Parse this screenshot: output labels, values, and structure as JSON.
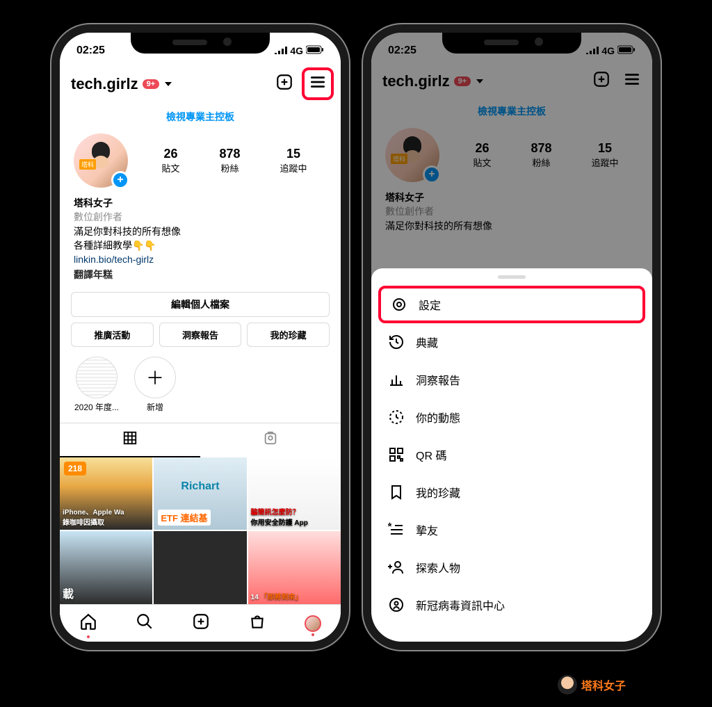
{
  "status": {
    "time": "02:25",
    "network": "4G"
  },
  "header": {
    "username": "tech.girlz",
    "badge": "9+"
  },
  "dashboard_link": "檢視專業主控板",
  "stats": {
    "posts": {
      "num": "26",
      "label": "貼文"
    },
    "followers": {
      "num": "878",
      "label": "粉絲"
    },
    "following": {
      "num": "15",
      "label": "追蹤中"
    }
  },
  "bio": {
    "name": "塔科女子",
    "category": "數位創作者",
    "line1": "滿足你對科技的所有想像",
    "line2": "各種詳細教學👇👇",
    "link": "linkin.bio/tech-girlz",
    "translate": "翻譯年糕"
  },
  "avatar_badge": "塔科",
  "edit_profile": "編輯個人檔案",
  "buttons": {
    "promo": "推廣活動",
    "insights": "洞察報告",
    "saved": "我的珍藏"
  },
  "highlights": {
    "h1": "2020 年度...",
    "add": "新增"
  },
  "grid": {
    "c1_badge": "218",
    "c1_line": "iPhone、Apple Wa",
    "c1_line2": "錄咖啡因攝取",
    "c2_title": "Richart",
    "c2_sub": "ETF 連結基",
    "c3_line": "騙簡訊怎麼防？",
    "c3_line2": "你用安全防護 App",
    "c4_text": "載",
    "c6_text": "「即將到來」",
    "c6_num": "14"
  },
  "menu": {
    "settings": "設定",
    "archive": "典藏",
    "insights": "洞察報告",
    "activity": "你的動態",
    "qr": "QR 碼",
    "saved": "我的珍藏",
    "close_friends": "摯友",
    "discover": "探索人物",
    "covid": "新冠病毒資訊中心"
  },
  "watermark": "塔科女子"
}
